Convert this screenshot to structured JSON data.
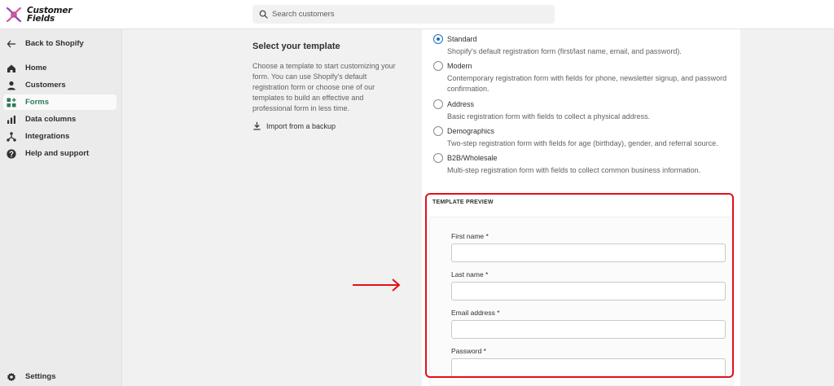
{
  "app": {
    "logo_line1": "Customer",
    "logo_line2": "Fields"
  },
  "search": {
    "placeholder": "Search customers"
  },
  "sidebar": {
    "back_label": "Back to Shopify",
    "items": [
      {
        "label": "Home",
        "icon": "home-icon"
      },
      {
        "label": "Customers",
        "icon": "person-icon"
      },
      {
        "label": "Forms",
        "icon": "forms-icon",
        "active": true
      },
      {
        "label": "Data columns",
        "icon": "bar-chart-icon"
      },
      {
        "label": "Integrations",
        "icon": "integrations-icon"
      },
      {
        "label": "Help and support",
        "icon": "help-icon"
      }
    ],
    "settings_label": "Settings"
  },
  "template_section": {
    "title": "Select your template",
    "description": "Choose a template to start customizing your form. You can use Shopify's default registration form or choose one of our templates to build an effective and professional form in less time.",
    "import_label": "Import from a backup"
  },
  "templates": [
    {
      "label": "Standard",
      "description": "Shopify's default registration form (first/last name, email, and password).",
      "selected": true
    },
    {
      "label": "Modern",
      "description": "Contemporary registration form with fields for phone, newsletter signup, and password confirmation.",
      "selected": false
    },
    {
      "label": "Address",
      "description": "Basic registration form with fields to collect a physical address.",
      "selected": false
    },
    {
      "label": "Demographics",
      "description": "Two-step registration form with fields for age (birthday), gender, and referral source.",
      "selected": false
    },
    {
      "label": "B2B/Wholesale",
      "description": "Multi-step registration form with fields to collect common business information.",
      "selected": false
    }
  ],
  "preview": {
    "title": "TEMPLATE PREVIEW",
    "fields": [
      {
        "label": "First name *",
        "value": ""
      },
      {
        "label": "Last name *",
        "value": ""
      },
      {
        "label": "Email address *",
        "value": ""
      },
      {
        "label": "Password *",
        "value": ""
      }
    ]
  },
  "colors": {
    "accent_green": "#2e7b56",
    "radio_blue": "#1f6fbf",
    "annotation_red": "#e3101a"
  }
}
